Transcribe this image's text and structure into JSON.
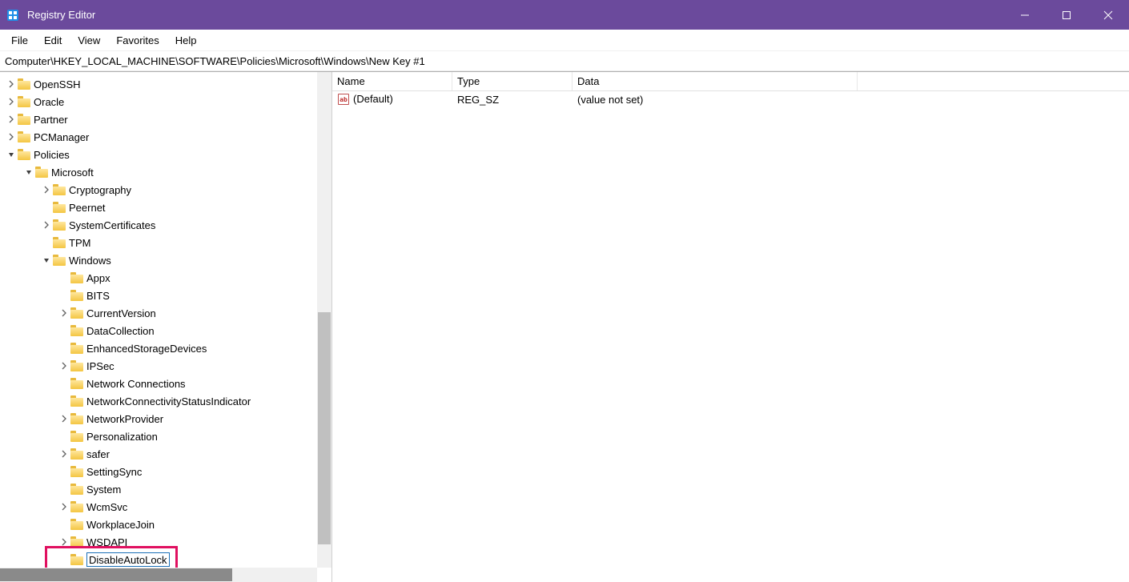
{
  "window": {
    "title": "Registry Editor"
  },
  "menu": {
    "items": [
      "File",
      "Edit",
      "View",
      "Favorites",
      "Help"
    ]
  },
  "address": {
    "path": "Computer\\HKEY_LOCAL_MACHINE\\SOFTWARE\\Policies\\Microsoft\\Windows\\New Key #1"
  },
  "tree": [
    {
      "indent": 3,
      "expand": "closed",
      "label": "OpenSSH"
    },
    {
      "indent": 3,
      "expand": "closed",
      "label": "Oracle"
    },
    {
      "indent": 3,
      "expand": "closed",
      "label": "Partner"
    },
    {
      "indent": 3,
      "expand": "closed",
      "label": "PCManager"
    },
    {
      "indent": 3,
      "expand": "open",
      "label": "Policies"
    },
    {
      "indent": 4,
      "expand": "open",
      "label": "Microsoft"
    },
    {
      "indent": 5,
      "expand": "closed",
      "label": "Cryptography"
    },
    {
      "indent": 5,
      "expand": "none",
      "label": "Peernet"
    },
    {
      "indent": 5,
      "expand": "closed",
      "label": "SystemCertificates"
    },
    {
      "indent": 5,
      "expand": "none",
      "label": "TPM"
    },
    {
      "indent": 5,
      "expand": "open",
      "label": "Windows"
    },
    {
      "indent": 6,
      "expand": "none",
      "label": "Appx"
    },
    {
      "indent": 6,
      "expand": "none",
      "label": "BITS"
    },
    {
      "indent": 6,
      "expand": "closed",
      "label": "CurrentVersion"
    },
    {
      "indent": 6,
      "expand": "none",
      "label": "DataCollection"
    },
    {
      "indent": 6,
      "expand": "none",
      "label": "EnhancedStorageDevices"
    },
    {
      "indent": 6,
      "expand": "closed",
      "label": "IPSec"
    },
    {
      "indent": 6,
      "expand": "none",
      "label": "Network Connections"
    },
    {
      "indent": 6,
      "expand": "none",
      "label": "NetworkConnectivityStatusIndicator"
    },
    {
      "indent": 6,
      "expand": "closed",
      "label": "NetworkProvider"
    },
    {
      "indent": 6,
      "expand": "none",
      "label": "Personalization"
    },
    {
      "indent": 6,
      "expand": "closed",
      "label": "safer"
    },
    {
      "indent": 6,
      "expand": "none",
      "label": "SettingSync"
    },
    {
      "indent": 6,
      "expand": "none",
      "label": "System"
    },
    {
      "indent": 6,
      "expand": "closed",
      "label": "WcmSvc"
    },
    {
      "indent": 6,
      "expand": "none",
      "label": "WorkplaceJoin"
    },
    {
      "indent": 6,
      "expand": "closed",
      "label": "WSDAPI"
    },
    {
      "indent": 6,
      "expand": "none",
      "label": "DisableAutoLock",
      "editing": true
    }
  ],
  "list": {
    "columns": {
      "name": "Name",
      "type": "Type",
      "data": "Data"
    },
    "rows": [
      {
        "name": "(Default)",
        "type": "REG_SZ",
        "data": "(value not set)"
      }
    ]
  }
}
